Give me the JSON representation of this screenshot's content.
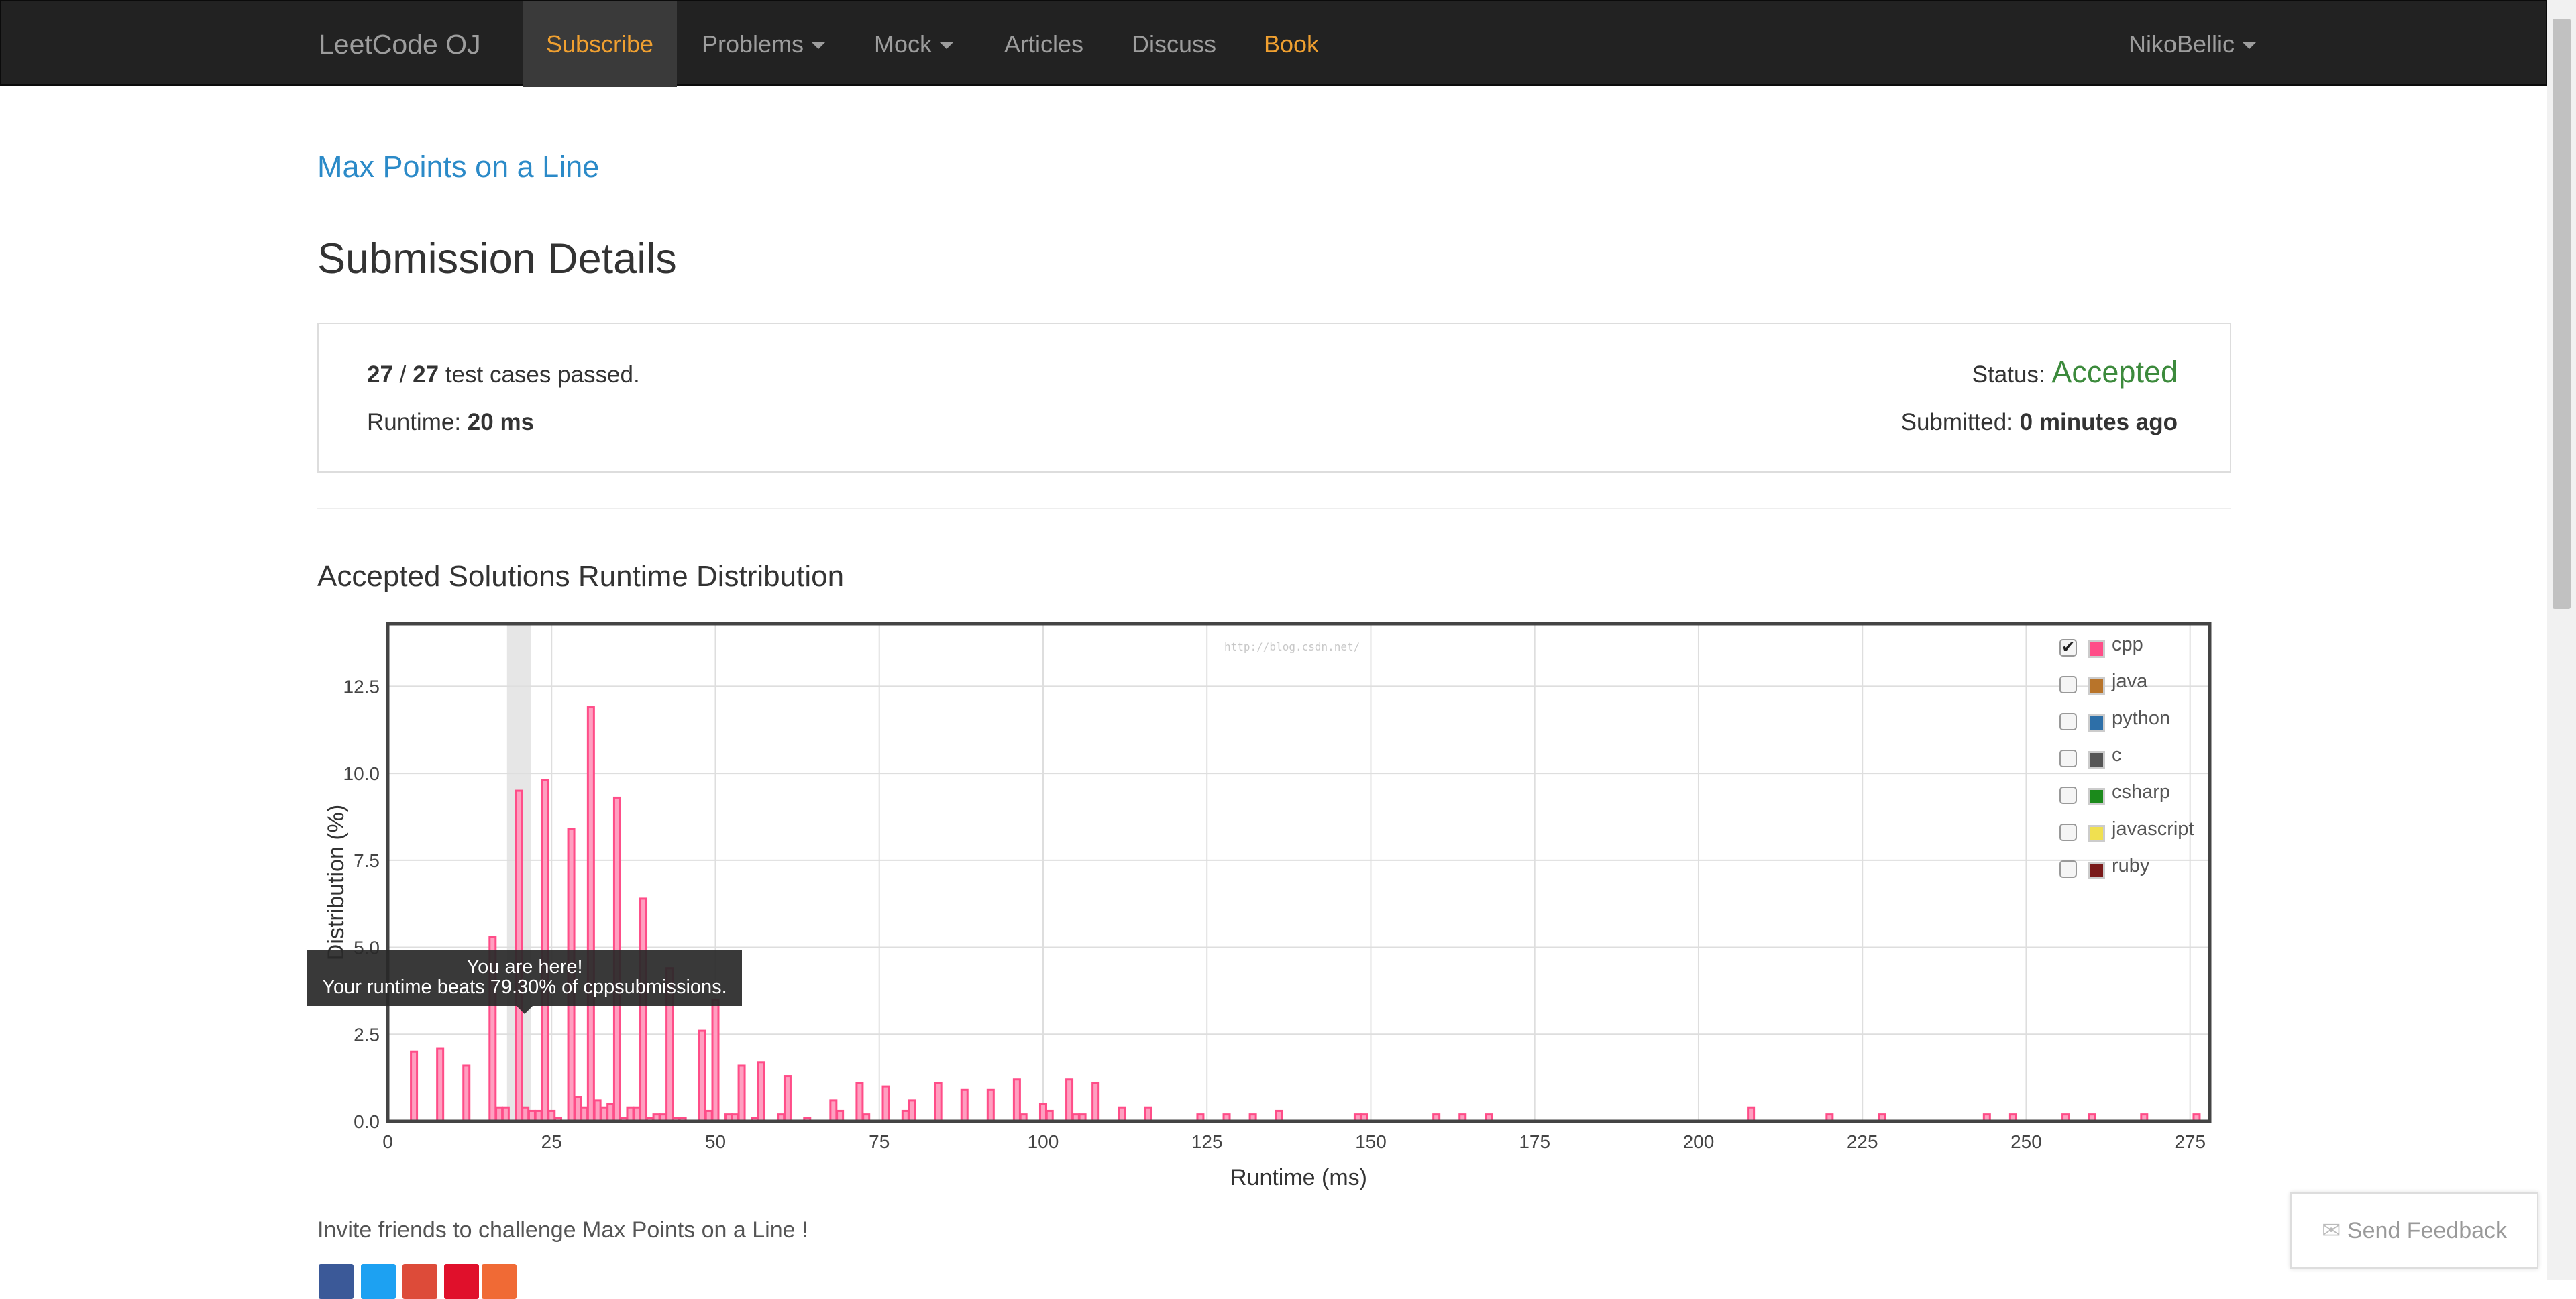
{
  "nav": {
    "brand": "LeetCode OJ",
    "items": [
      {
        "label": "Subscribe"
      },
      {
        "label": "Problems"
      },
      {
        "label": "Mock"
      },
      {
        "label": "Articles"
      },
      {
        "label": "Discuss"
      },
      {
        "label": "Book"
      }
    ],
    "user": "NikoBellic"
  },
  "problem_link": "Max Points on a Line",
  "page_title": "Submission Details",
  "details": {
    "passed": "27",
    "sep": "/",
    "total": "27",
    "passed_suffix": "test cases passed.",
    "runtime_label": "Runtime:",
    "runtime_value": "20 ms",
    "status_label": "Status:",
    "status_value": "Accepted",
    "submitted_label": "Submitted:",
    "submitted_value": "0 minutes ago"
  },
  "section_title": "Accepted Solutions Runtime Distribution",
  "tooltip": {
    "line1": "You are here!",
    "line2": "Your runtime beats 79.30% of cppsubmissions."
  },
  "watermark": "http://blog.csdn.net/",
  "legend": [
    {
      "label": "cpp",
      "checked": true,
      "color": "#ff4d88"
    },
    {
      "label": "java",
      "checked": false,
      "color": "#b8742a"
    },
    {
      "label": "python",
      "checked": false,
      "color": "#2d6fa8"
    },
    {
      "label": "c",
      "checked": false,
      "color": "#555555"
    },
    {
      "label": "csharp",
      "checked": false,
      "color": "#1b8a1b"
    },
    {
      "label": "javascript",
      "checked": false,
      "color": "#f0e050"
    },
    {
      "label": "ruby",
      "checked": false,
      "color": "#7a1a1a"
    }
  ],
  "chart_data": {
    "type": "bar",
    "xlabel": "Runtime (ms)",
    "ylabel": "Distribution (%)",
    "xlim": [
      0,
      278
    ],
    "ylim": [
      0,
      14.3
    ],
    "xticks": [
      0,
      25,
      50,
      75,
      100,
      125,
      150,
      175,
      200,
      225,
      250,
      275
    ],
    "yticks": [
      0.0,
      2.5,
      5.0,
      7.5,
      10.0,
      12.5
    ],
    "highlight_x": 20,
    "series": [
      {
        "name": "cpp",
        "color": "#ff4d88",
        "x": [
          4,
          8,
          12,
          16,
          17,
          18,
          20,
          21,
          22,
          23,
          24,
          25,
          26,
          28,
          29,
          30,
          31,
          32,
          33,
          34,
          35,
          36,
          37,
          38,
          39,
          40,
          41,
          42,
          43,
          44,
          45,
          48,
          49,
          50,
          52,
          53,
          54,
          56,
          57,
          60,
          61,
          64,
          68,
          69,
          72,
          73,
          76,
          79,
          80,
          84,
          88,
          92,
          96,
          97,
          100,
          101,
          104,
          105,
          106,
          108,
          112,
          116,
          124,
          128,
          132,
          136,
          148,
          149,
          160,
          164,
          168,
          208,
          220,
          228,
          244,
          248,
          256,
          260,
          268,
          276
        ],
        "values": [
          2.0,
          2.1,
          1.6,
          5.3,
          0.4,
          0.4,
          9.5,
          0.4,
          0.3,
          0.3,
          9.8,
          0.3,
          0.1,
          8.4,
          0.7,
          0.4,
          11.9,
          0.6,
          0.4,
          0.5,
          9.3,
          0.1,
          0.4,
          0.4,
          6.4,
          0.1,
          0.2,
          0.2,
          4.4,
          0.1,
          0.1,
          2.6,
          0.3,
          3.5,
          0.2,
          0.2,
          1.6,
          0.1,
          1.7,
          0.2,
          1.3,
          0.1,
          0.6,
          0.3,
          1.1,
          0.2,
          1.0,
          0.3,
          0.6,
          1.1,
          0.9,
          0.9,
          1.2,
          0.2,
          0.5,
          0.3,
          1.2,
          0.2,
          0.2,
          1.1,
          0.4,
          0.4,
          0.2,
          0.2,
          0.2,
          0.3,
          0.2,
          0.2,
          0.2,
          0.2,
          0.2,
          0.4,
          0.2,
          0.2,
          0.2,
          0.2,
          0.2,
          0.2,
          0.2,
          0.2
        ]
      }
    ]
  },
  "invite_text": "Invite friends to challenge Max Points on a Line !",
  "feedback_label": "Send Feedback",
  "social_colors": [
    "#3b5998",
    "#1da1f2",
    "#dd4b39",
    "#e0102b",
    "#f06a35"
  ]
}
